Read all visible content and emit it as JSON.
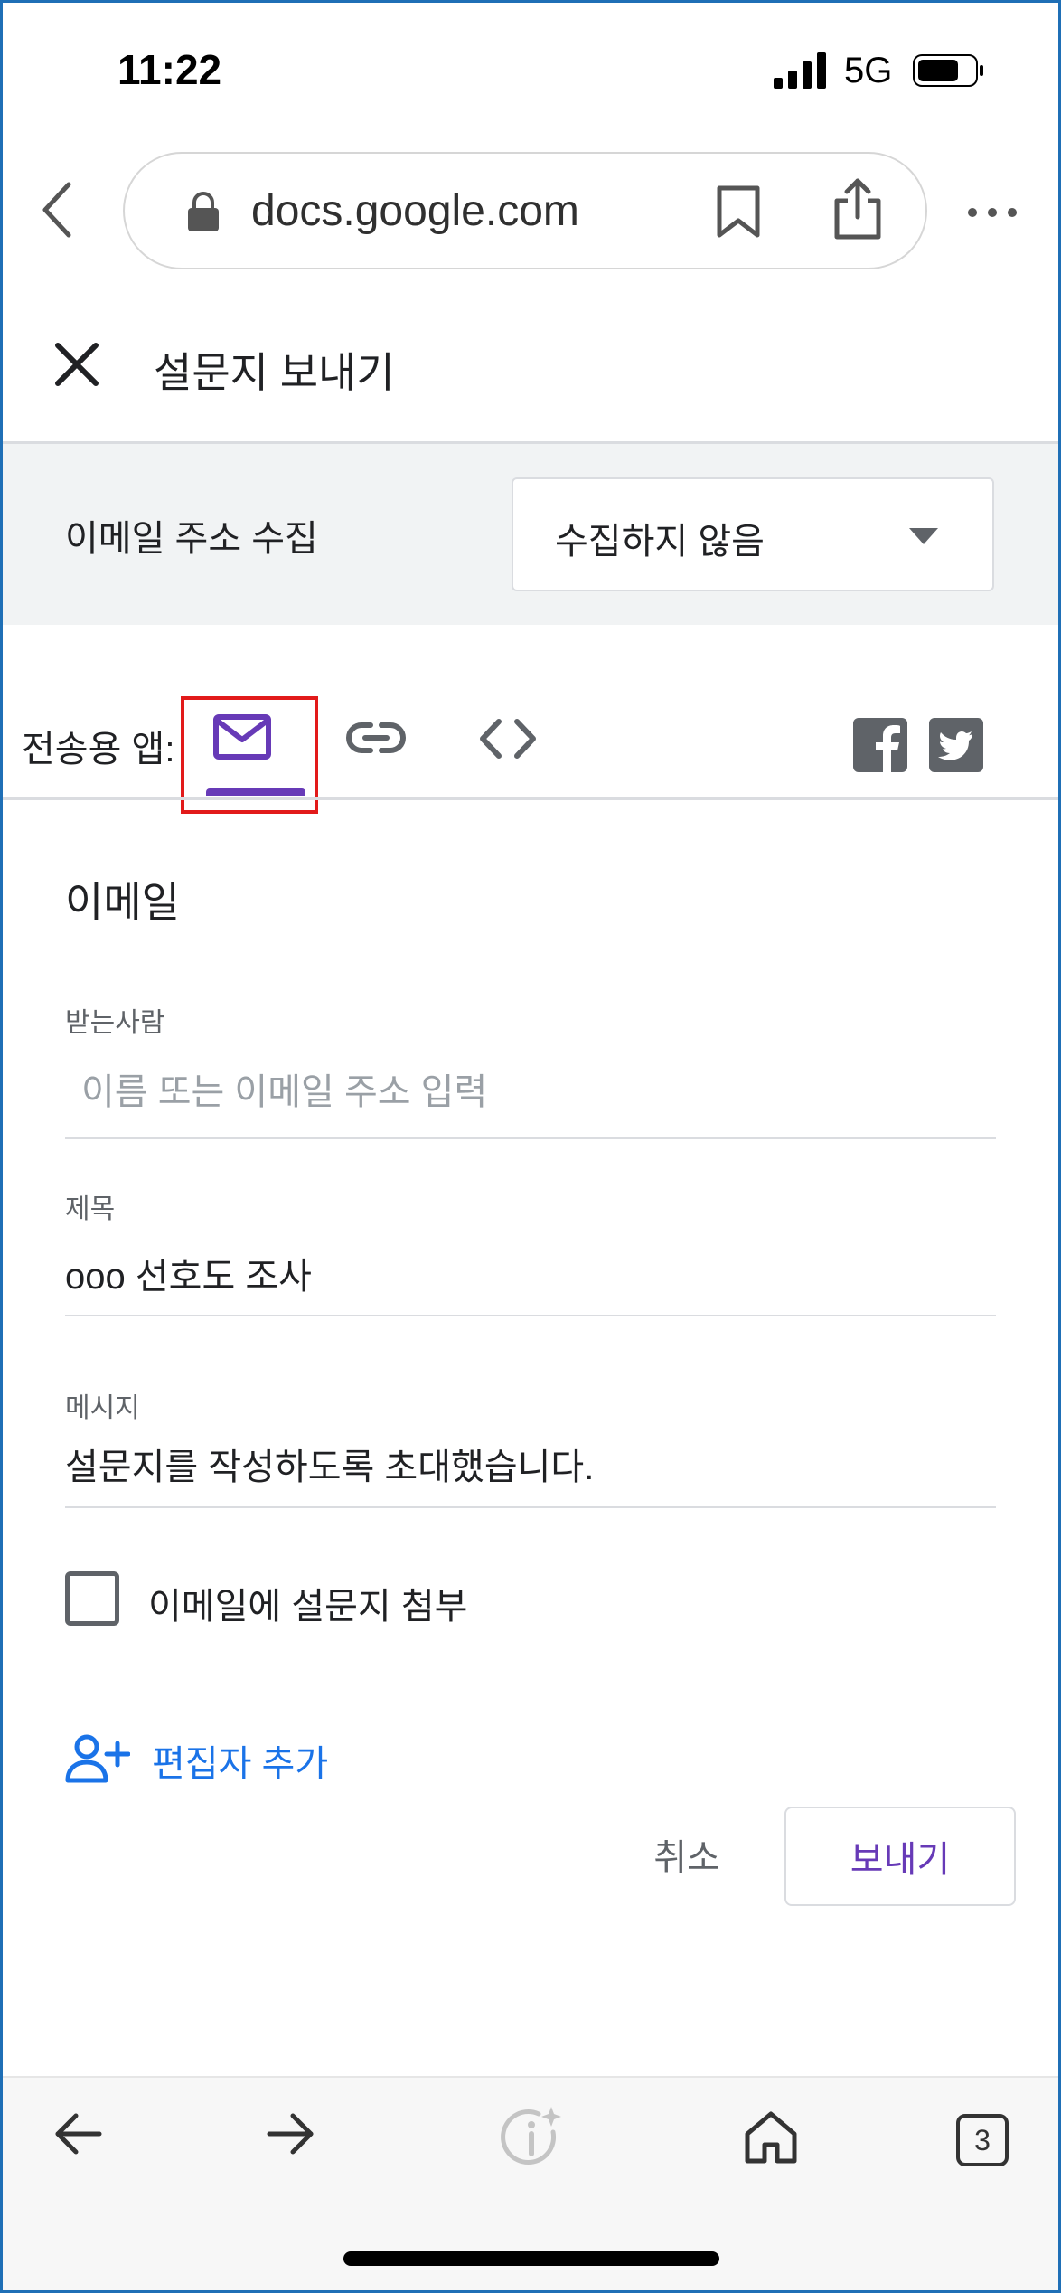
{
  "status_bar": {
    "time": "11:22",
    "network": "5G"
  },
  "browser": {
    "url": "docs.google.com"
  },
  "dialog": {
    "title": "설문지 보내기"
  },
  "collect_email": {
    "label": "이메일 주소 수집",
    "selected": "수집하지 않음"
  },
  "send_via": {
    "label": "전송용 앱:",
    "active_tab": "email",
    "tabs": [
      "mail-icon",
      "link-icon",
      "code-icon"
    ],
    "social": [
      "facebook-icon",
      "twitter-icon"
    ]
  },
  "email_form": {
    "section_title": "이메일",
    "to": {
      "label": "받는사람",
      "placeholder": "이름 또는 이메일 주소 입력",
      "value": ""
    },
    "subject": {
      "label": "제목",
      "value": "ooo 선호도 조사"
    },
    "message": {
      "label": "메시지",
      "value": "설문지를 작성하도록 초대했습니다."
    },
    "attach_checkbox": {
      "label": "이메일에 설문지 첨부",
      "checked": false
    },
    "add_editors": "편집자 추가"
  },
  "actions": {
    "cancel": "취소",
    "send": "보내기"
  },
  "bottom_toolbar": {
    "tab_count": "3"
  },
  "colors": {
    "accent": "#673ab7",
    "link_blue": "#1a73e8",
    "highlight_red": "#e21a1a",
    "band_gray": "#f1f3f4"
  }
}
